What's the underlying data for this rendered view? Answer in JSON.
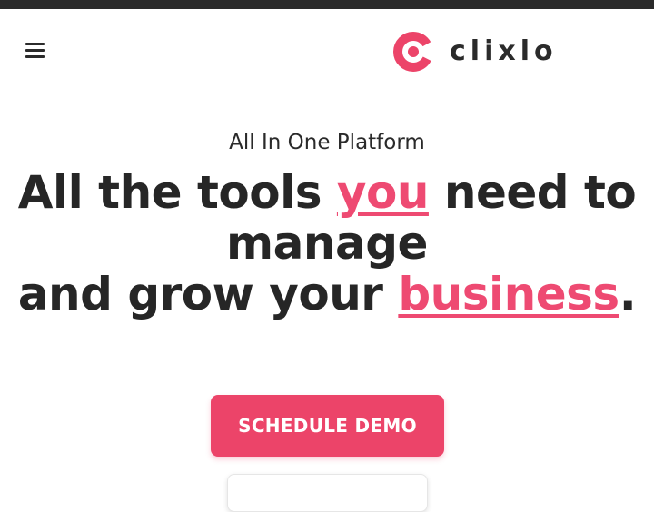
{
  "header": {
    "menu_icon": "hamburger-icon",
    "logo_icon": "clixlo-c-icon",
    "logo_text": "clixlo"
  },
  "hero": {
    "eyebrow": "All In One Platform",
    "headline": {
      "line1_before": "All the tools ",
      "line1_highlight": "you",
      "line1_after": " need to",
      "line2": "manage",
      "line3_before": "and grow your ",
      "line3_highlight": "business",
      "line3_after": "."
    },
    "cta_label": "SCHEDULE DEMO"
  },
  "colors": {
    "accent": "#ec4469",
    "text": "#262626",
    "topbar": "#2b2b2b"
  }
}
